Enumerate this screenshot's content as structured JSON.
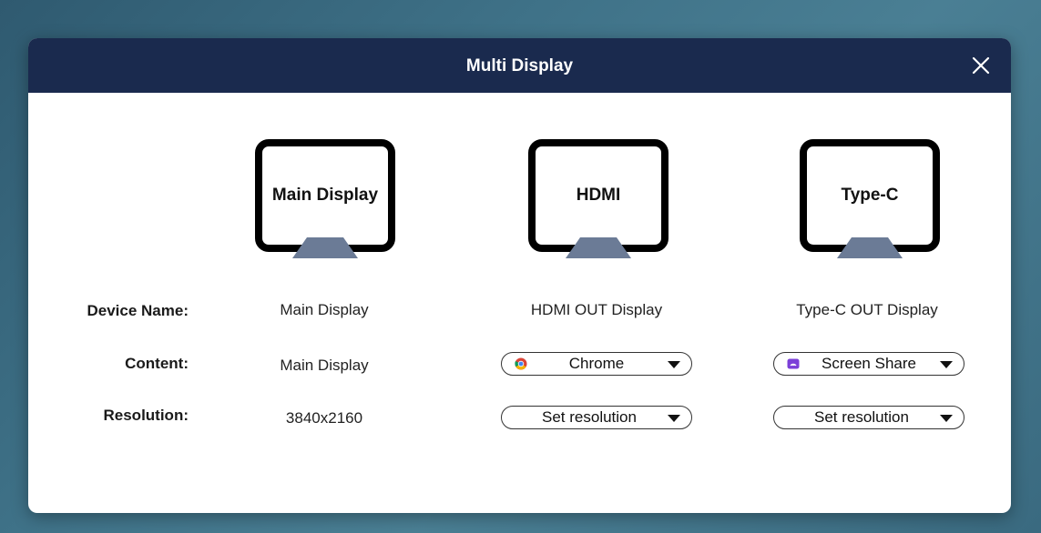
{
  "dialog": {
    "title": "Multi Display"
  },
  "icons": {
    "close": "close-icon",
    "chrome": "chrome-icon",
    "screen_share": "screen-share-icon"
  },
  "colors": {
    "titlebar": "#1a2a4e",
    "stand": "#6b7b96",
    "background": "#3f7288"
  },
  "labels": {
    "device_name": "Device Name:",
    "content": "Content:",
    "resolution": "Resolution:"
  },
  "displays": [
    {
      "screen_label": "Main Display",
      "device_name": "Main Display",
      "content": "Main Display",
      "resolution": "3840x2160"
    },
    {
      "screen_label": "HDMI",
      "device_name": "HDMI OUT Display",
      "content": "Chrome",
      "resolution": "Set resolution"
    },
    {
      "screen_label": "Type-C",
      "device_name": "Type-C OUT Display",
      "content": "Screen Share",
      "resolution": "Set resolution"
    }
  ]
}
